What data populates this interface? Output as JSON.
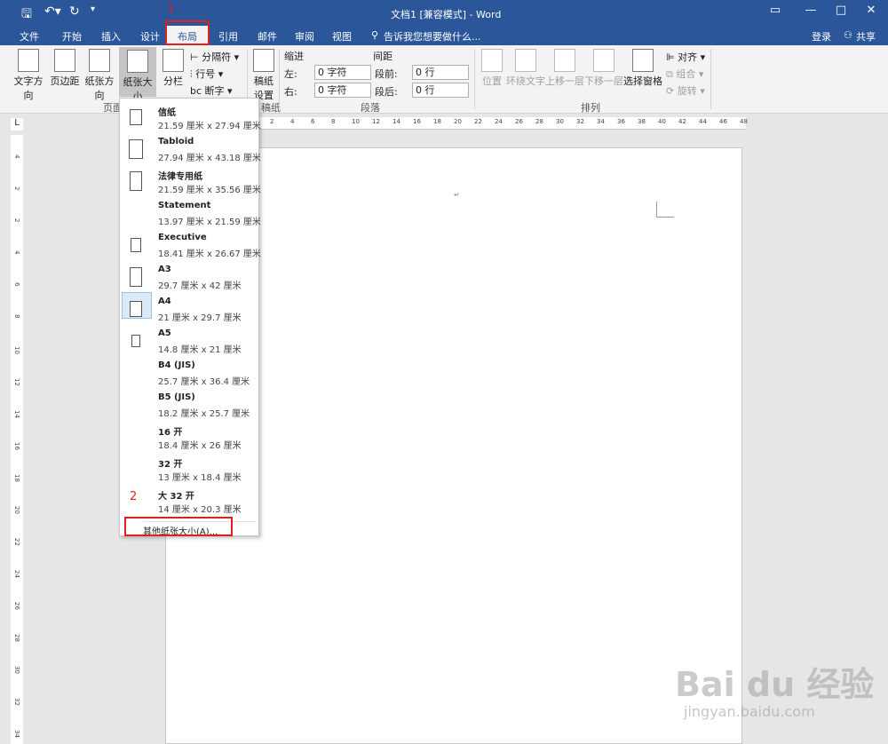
{
  "window": {
    "title": "文档1 [兼容模式] - Word",
    "help_icon": "ribbon-display-icon",
    "minimize": "minimize-icon",
    "maximize": "maximize-icon",
    "close": "close-icon"
  },
  "tabs": [
    "文件",
    "开始",
    "插入",
    "设计",
    "布局",
    "引用",
    "邮件",
    "审阅",
    "视图"
  ],
  "active_tab": "布局",
  "tell_me": "告诉我您想要做什么...",
  "signin": "登录",
  "share": "共享",
  "ribbon": {
    "page_setup": {
      "text_direction": "文字方向",
      "margins": "页边距",
      "orientation": "纸张方向",
      "size": "纸张大小",
      "columns": "分栏",
      "breaks": "分隔符",
      "line_numbers": "行号",
      "hyphenation": "断字",
      "group": "页面设置"
    },
    "draft": {
      "label": "稿纸设置",
      "group": "稿纸"
    },
    "paragraph": {
      "indent": "缩进",
      "left": "左:",
      "right": "右:",
      "left_val": "0 字符",
      "right_val": "0 字符",
      "spacing": "间距",
      "before": "段前:",
      "after": "段后:",
      "before_val": "0 行",
      "after_val": "0 行",
      "group": "段落"
    },
    "arrange": {
      "position": "位置",
      "wrap": "环绕文字",
      "forward": "上移一层",
      "backward": "下移一层",
      "pane": "选择窗格",
      "align": "对齐",
      "group_btn": "组合",
      "rotate": "旋转",
      "group": "排列"
    }
  },
  "ruler_h": [
    "2",
    "4",
    "6",
    "8",
    "10",
    "12",
    "14",
    "16",
    "18",
    "20",
    "22",
    "24",
    "26",
    "28",
    "30",
    "32",
    "34",
    "36",
    "38",
    "40",
    "42",
    "44",
    "46",
    "48"
  ],
  "ruler_v": [
    "4",
    "2",
    "2",
    "4",
    "6",
    "8",
    "10",
    "12",
    "14",
    "16",
    "18",
    "20",
    "22",
    "24",
    "26",
    "28",
    "30",
    "32",
    "34"
  ],
  "paper_sizes": [
    {
      "name": "信纸",
      "dim": "21.59 厘米 x 27.94 厘米"
    },
    {
      "name": "Tabloid",
      "dim": "27.94 厘米 x 43.18 厘米"
    },
    {
      "name": "法律专用纸",
      "dim": "21.59 厘米 x 35.56 厘米"
    },
    {
      "name": "Statement",
      "dim": "13.97 厘米 x 21.59 厘米"
    },
    {
      "name": "Executive",
      "dim": "18.41 厘米 x 26.67 厘米"
    },
    {
      "name": "A3",
      "dim": "29.7 厘米 x 42 厘米"
    },
    {
      "name": "A4",
      "dim": "21 厘米 x 29.7 厘米"
    },
    {
      "name": "A5",
      "dim": "14.8 厘米 x 21 厘米"
    },
    {
      "name": "B4 (JIS)",
      "dim": "25.7 厘米 x 36.4 厘米"
    },
    {
      "name": "B5 (JIS)",
      "dim": "18.2 厘米 x 25.7 厘米"
    },
    {
      "name": "16 开",
      "dim": "18.4 厘米 x 26 厘米"
    },
    {
      "name": "32 开",
      "dim": "13 厘米 x 18.4 厘米"
    },
    {
      "name": "大 32 开",
      "dim": "14 厘米 x 20.3 厘米"
    }
  ],
  "selected_size": "A4",
  "more_sizes": "其他纸张大小(A)...",
  "annotations": {
    "step1": "1",
    "step2": "2"
  },
  "watermark": {
    "brand": "Bai du 经验",
    "url": "jingyan.baidu.com"
  },
  "colors": {
    "accent": "#2b579a",
    "annotation": "#e02020"
  }
}
